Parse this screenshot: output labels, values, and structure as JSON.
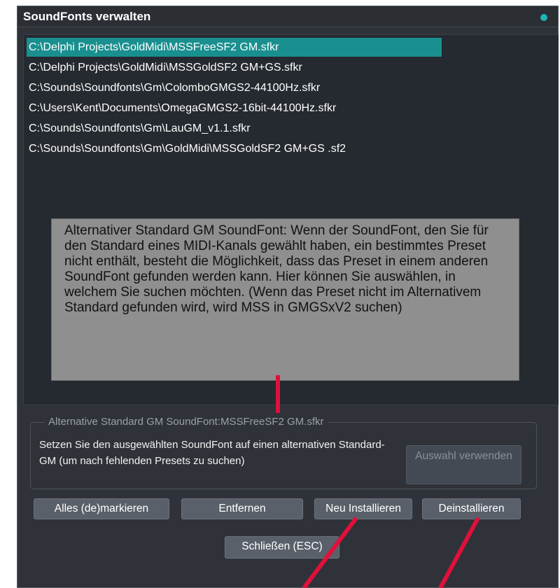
{
  "window": {
    "title": "SoundFonts verwalten"
  },
  "soundfonts": [
    {
      "path": "C:\\Delphi Projects\\GoldMidi\\MSSFreeSF2 GM.sfkr",
      "selected": true
    },
    {
      "path": "C:\\Delphi Projects\\GoldMidi\\MSSGoldSF2 GM+GS.sfkr",
      "selected": false
    },
    {
      "path": "C:\\Sounds\\Soundfonts\\Gm\\ColomboGMGS2-44100Hz.sfkr",
      "selected": false
    },
    {
      "path": "C:\\Users\\Kent\\Documents\\OmegaGMGS2-16bit-44100Hz.sfkr",
      "selected": false
    },
    {
      "path": "C:\\Sounds\\Soundfonts\\Gm\\LauGM_v1.1.sfkr",
      "selected": false
    },
    {
      "path": "C:\\Sounds\\Soundfonts\\Gm\\GoldMidi\\MSSGoldSF2 GM+GS .sf2",
      "selected": false
    }
  ],
  "tooltip": {
    "text": "Alternativer Standard GM SoundFont: Wenn der SoundFont, den Sie für den Standard eines MIDI-Kanals gewählt haben, ein bestimmtes Preset nicht enthält, besteht die Möglichkeit, dass das Preset in einem anderen SoundFont gefunden werden kann. Hier können Sie auswählen, in welchem Sie suchen möchten. (Wenn das Preset nicht im Alternativem Standard gefunden wird, wird MSS in GMGSxV2 suchen)"
  },
  "alt_group": {
    "legend": "Alternative Standard GM SoundFont:MSSFreeSF2 GM.sfkr",
    "description": "Setzen Sie den ausgewählten SoundFont auf einen alternativen Standard-GM (um nach fehlenden Presets zu suchen)",
    "use_selection_label": "Auswahl verwenden"
  },
  "buttons": {
    "toggle_all": "Alles (de)markieren",
    "remove": "Entfernen",
    "install": "Neu Installieren",
    "uninstall": "Deinstallieren",
    "close": "Schließen (ESC)"
  },
  "colors": {
    "accent": "#1a8f8f",
    "status_dot": "#1fb5b5",
    "annotation_red": "#e0103a",
    "tooltip_bg": "#8f8f8f"
  }
}
